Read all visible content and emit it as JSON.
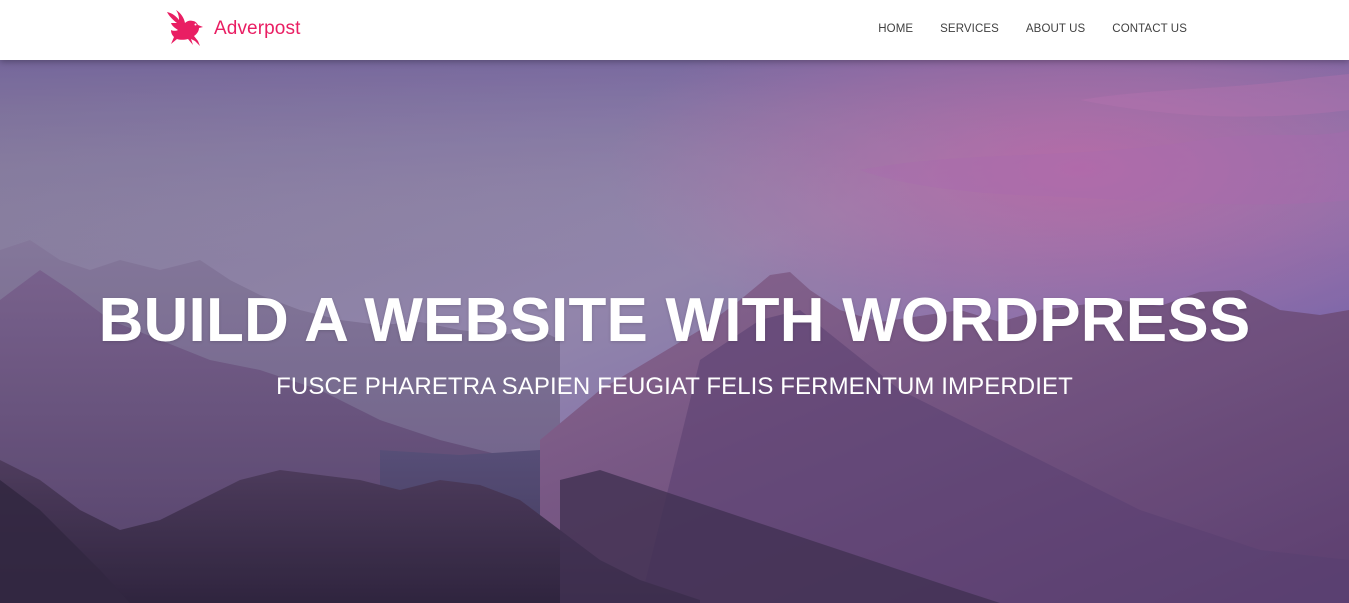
{
  "header": {
    "brand": {
      "name": "Adverpost",
      "logo_icon": "eagle-icon",
      "color": "#e91e63"
    },
    "nav": [
      {
        "label": "HOME"
      },
      {
        "label": "SERVICES"
      },
      {
        "label": "ABOUT US"
      },
      {
        "label": "CONTACT US"
      }
    ]
  },
  "hero": {
    "title": "BUILD A WEBSITE WITH WORDPRESS",
    "subtitle": "FUSCE PHARETRA SAPIEN FEUGIAT FELIS FERMENTUM IMPERDIET",
    "background": "mountain-landscape-photo",
    "overlay_color": "#6a4fa3"
  }
}
